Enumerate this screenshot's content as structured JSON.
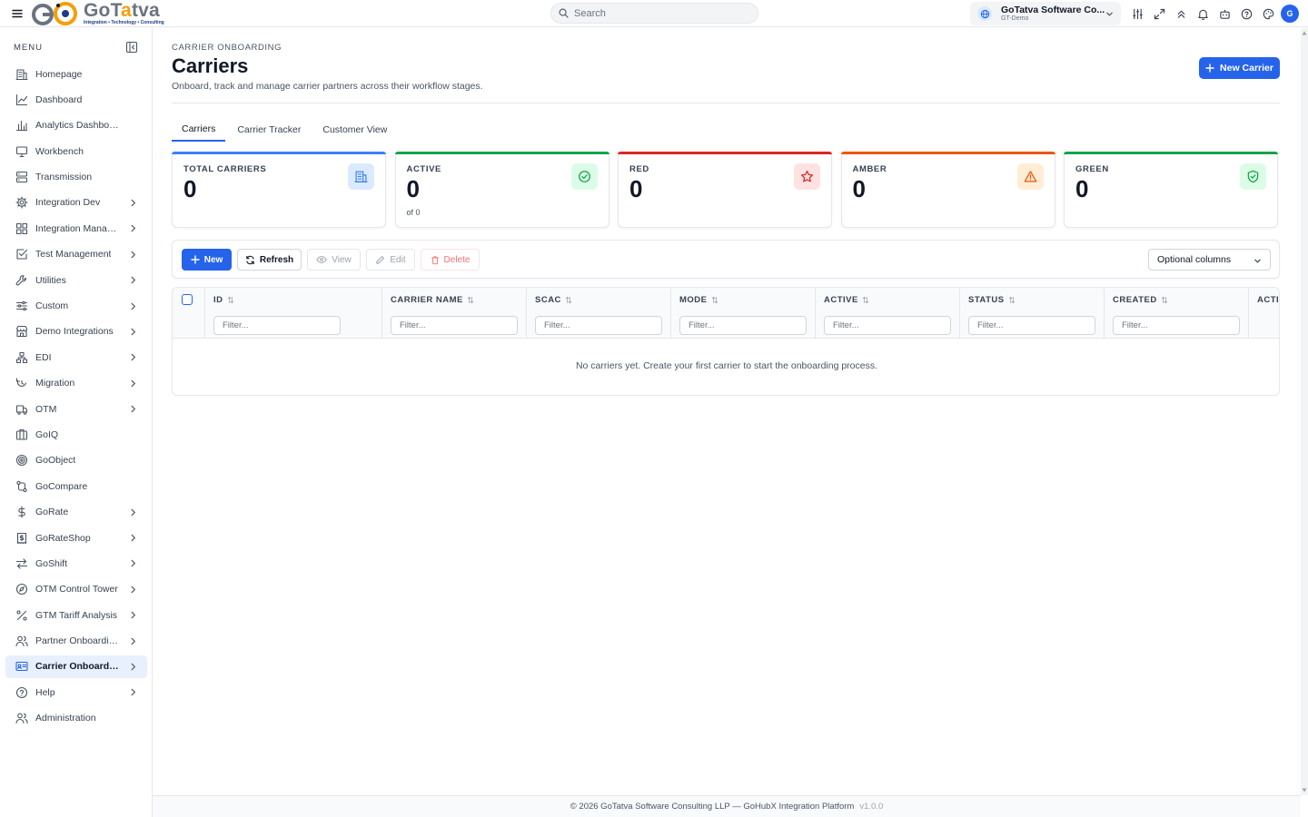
{
  "app": {
    "logo_text_go": "Go",
    "logo_text_rest_1": "T",
    "logo_text_a": "a",
    "logo_text_rest_2": "tva",
    "logo_tagline": "Integration • Technology • Consulting"
  },
  "topbar": {
    "search_placeholder": "Search",
    "org_name": "GoTatva Software Co...",
    "org_sub": "GT-Demo",
    "avatar_initial": "G",
    "icons": [
      "sliders-icon",
      "expand-icon",
      "chevrons-up-icon",
      "bell-icon",
      "robot-icon",
      "help-icon",
      "palette-icon"
    ]
  },
  "sidebar": {
    "menu_label": "MENU",
    "items": [
      {
        "label": "Homepage",
        "icon": "building-icon",
        "chevron": false,
        "active": false
      },
      {
        "label": "Dashboard",
        "icon": "line-chart-icon",
        "chevron": false,
        "active": false
      },
      {
        "label": "Analytics Dashboard",
        "icon": "bar-chart-icon",
        "chevron": false,
        "active": false
      },
      {
        "label": "Workbench",
        "icon": "monitor-icon",
        "chevron": false,
        "active": false
      },
      {
        "label": "Transmission",
        "icon": "server-icon",
        "chevron": false,
        "active": false
      },
      {
        "label": "Integration Dev",
        "icon": "gear-icon",
        "chevron": true,
        "active": false
      },
      {
        "label": "Integration Manag...",
        "icon": "grid-icon",
        "chevron": true,
        "active": false
      },
      {
        "label": "Test Management",
        "icon": "checkbox-icon",
        "chevron": true,
        "active": false
      },
      {
        "label": "Utilities",
        "icon": "wrench-icon",
        "chevron": true,
        "active": false
      },
      {
        "label": "Custom",
        "icon": "sliders-icon",
        "chevron": true,
        "active": false
      },
      {
        "label": "Demo Integrations",
        "icon": "store-icon",
        "chevron": true,
        "active": false
      },
      {
        "label": "EDI",
        "icon": "network-icon",
        "chevron": true,
        "active": false
      },
      {
        "label": "Migration",
        "icon": "migration-icon",
        "chevron": true,
        "active": false
      },
      {
        "label": "OTM",
        "icon": "truck-icon",
        "chevron": true,
        "active": false
      },
      {
        "label": "GoIQ",
        "icon": "columns-icon",
        "chevron": false,
        "active": false
      },
      {
        "label": "GoObject",
        "icon": "target-icon",
        "chevron": false,
        "active": false
      },
      {
        "label": "GoCompare",
        "icon": "compare-icon",
        "chevron": false,
        "active": false
      },
      {
        "label": "GoRate",
        "icon": "dollar-icon",
        "chevron": true,
        "active": false
      },
      {
        "label": "GoRateShop",
        "icon": "receipt-icon",
        "chevron": true,
        "active": false
      },
      {
        "label": "GoShift",
        "icon": "arrows-swap-icon",
        "chevron": true,
        "active": false
      },
      {
        "label": "OTM Control Tower",
        "icon": "compass-icon",
        "chevron": true,
        "active": false
      },
      {
        "label": "GTM Tariff Analysis",
        "icon": "percent-icon",
        "chevron": true,
        "active": false
      },
      {
        "label": "Partner Onboarding",
        "icon": "users-icon",
        "chevron": true,
        "active": false
      },
      {
        "label": "Carrier Onboardi...",
        "icon": "id-card-icon",
        "chevron": true,
        "active": true
      },
      {
        "label": "Help",
        "icon": "help-icon",
        "chevron": true,
        "active": false
      },
      {
        "label": "Administration",
        "icon": "users-icon",
        "chevron": false,
        "active": false
      }
    ]
  },
  "page": {
    "eyebrow": "CARRIER ONBOARDING",
    "title": "Carriers",
    "subtitle": "Onboard, track and manage carrier partners across their workflow stages.",
    "new_button": "New Carrier"
  },
  "tabs": [
    {
      "label": "Carriers",
      "active": true
    },
    {
      "label": "Carrier Tracker",
      "active": false
    },
    {
      "label": "Customer View",
      "active": false
    }
  ],
  "stats": [
    {
      "label": "TOTAL CARRIERS",
      "value": "0",
      "sub": "",
      "color": "#3b82f6",
      "icon": "building-icon",
      "icon_bg": "#dbeafe"
    },
    {
      "label": "ACTIVE",
      "value": "0",
      "sub": "of 0",
      "color": "#16a34a",
      "icon": "check-circle-icon",
      "icon_bg": "#dcfce7"
    },
    {
      "label": "RED",
      "value": "0",
      "sub": "",
      "color": "#dc2626",
      "icon": "star-icon",
      "icon_bg": "#fee2e2"
    },
    {
      "label": "AMBER",
      "value": "0",
      "sub": "",
      "color": "#ea580c",
      "icon": "warning-icon",
      "icon_bg": "#ffedd5"
    },
    {
      "label": "GREEN",
      "value": "0",
      "sub": "",
      "color": "#16a34a",
      "icon": "shield-check-icon",
      "icon_bg": "#dcfce7"
    }
  ],
  "toolbar": {
    "new": "New",
    "refresh": "Refresh",
    "view": "View",
    "edit": "Edit",
    "delete": "Delete",
    "optional_columns": "Optional columns"
  },
  "table": {
    "columns": [
      "ID",
      "CARRIER NAME",
      "SCAC",
      "MODE",
      "ACTIVE",
      "STATUS",
      "CREATED",
      "ACTIONS"
    ],
    "filter_placeholder": "Filter...",
    "empty_message": "No carriers yet. Create your first carrier to start the onboarding process."
  },
  "footer": {
    "text": "© 2026 GoTatva Software Consulting LLP — GoHubX Integration Platform",
    "version": "v1.0.0"
  },
  "colors": {
    "primary": "#2563eb",
    "active_nav_bg": "#e8effd"
  }
}
